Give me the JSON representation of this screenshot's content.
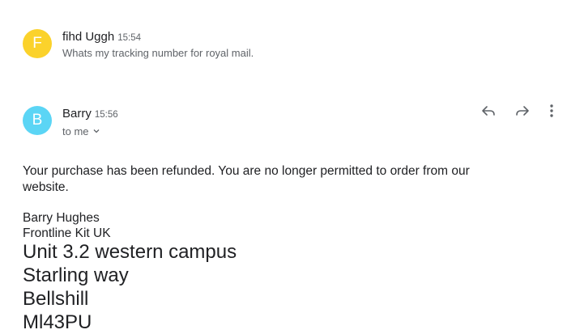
{
  "messages": [
    {
      "avatar_letter": "F",
      "avatar_color": "#fbd22b",
      "sender": "fihd Uggh",
      "time": "15:54",
      "snippet": "Whats my tracking number for royal mail."
    },
    {
      "avatar_letter": "B",
      "avatar_color": "#5bd5f5",
      "sender": "Barry",
      "time": "15:56",
      "recipient": "to me",
      "body_lines": [
        "Your purchase has been refunded. You are no longer permitted to order from our",
        "website."
      ],
      "signature_small": [
        "Barry Hughes",
        "Frontline Kit UK"
      ],
      "signature_large": [
        "Unit 3.2 western campus",
        "Starling way",
        "Bellshill",
        "Ml43PU"
      ]
    }
  ],
  "actions": {
    "reply_icon": "reply-icon",
    "forward_icon": "forward-icon",
    "more_icon": "more-vert-icon"
  }
}
